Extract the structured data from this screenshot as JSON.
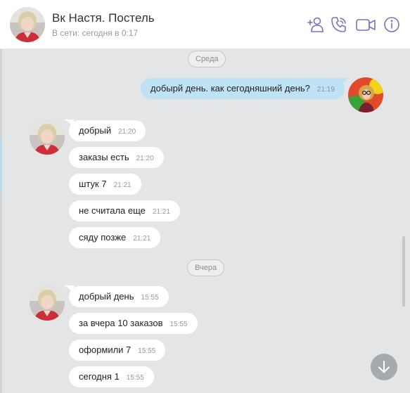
{
  "header": {
    "title": "Вк Настя. Постель",
    "status": "В сети: сегодня в 0:17",
    "icons": [
      "add-contact-icon",
      "phone-icon",
      "video-camera-icon",
      "info-icon"
    ],
    "accent_color": "#7c6fc2"
  },
  "chat": {
    "date_separators": [
      "Среда",
      "Вчера"
    ],
    "outgoing": [
      {
        "text": "добырй день. как сегодняшний день?",
        "time": "21:19"
      }
    ],
    "group1": [
      {
        "text": "добрый",
        "time": "21:20"
      },
      {
        "text": "заказы есть",
        "time": "21:20"
      },
      {
        "text": "штук 7",
        "time": "21:21"
      },
      {
        "text": "не считала еще",
        "time": "21:21"
      },
      {
        "text": "сяду позже",
        "time": "21:21"
      }
    ],
    "group2": [
      {
        "text": "добрый день",
        "time": "15:55"
      },
      {
        "text": "за вчера 10 заказов",
        "time": "15:55"
      },
      {
        "text": "оформили 7",
        "time": "15:55"
      },
      {
        "text": "сегодня 1",
        "time": "15:55"
      }
    ]
  },
  "colors": {
    "chat_background": "#e3e5e7",
    "incoming_bubble": "#ffffff",
    "outgoing_bubble": "#bfe2f4"
  }
}
